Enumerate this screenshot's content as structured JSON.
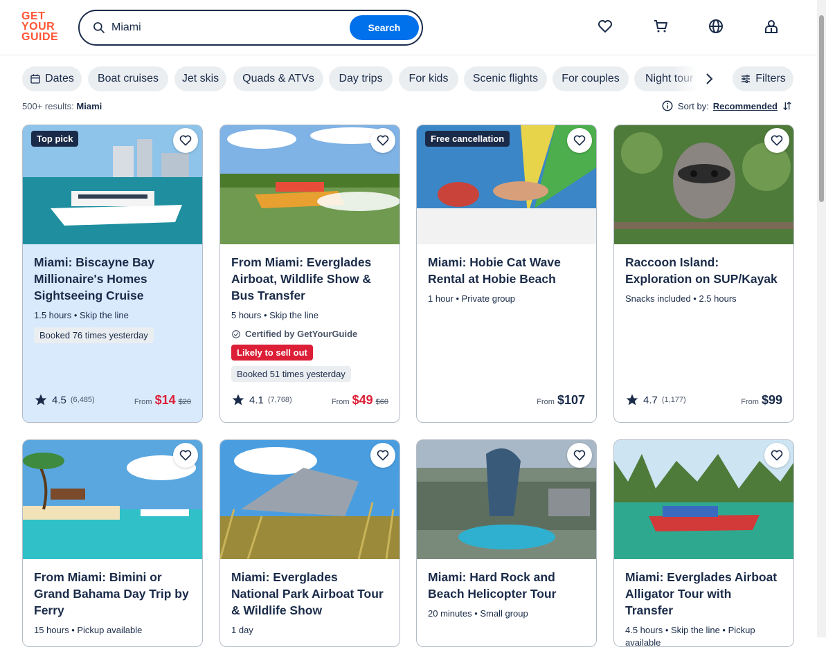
{
  "header": {
    "logo_lines": [
      "GET",
      "YOUR",
      "GUIDE"
    ],
    "search_value": "Miami",
    "search_button": "Search"
  },
  "chips": [
    "Dates",
    "Boat cruises",
    "Jet skis",
    "Quads & ATVs",
    "Day trips",
    "For kids",
    "Scenic flights",
    "For couples",
    "Night tour"
  ],
  "filters_label": "Filters",
  "results": {
    "count": "500+ results:",
    "query": "Miami"
  },
  "sort": {
    "label": "Sort by:",
    "value": "Recommended"
  },
  "cards": [
    {
      "tag": "Top pick",
      "title": "Miami: Biscayne Bay Millionaire's Homes Sightseeing Cruise",
      "meta": "1.5 hours • Skip the line",
      "booked": "Booked 76 times yesterday",
      "rating": "4.5",
      "reviews": "(6,485)",
      "from": "From",
      "price": "$14",
      "old": "$20"
    },
    {
      "title": "From Miami: Everglades Airboat, Wildlife Show & Bus Transfer",
      "meta": "5 hours • Skip the line",
      "cert": "Certified by GetYourGuide",
      "alert": "Likely to sell out",
      "booked": "Booked 51 times yesterday",
      "rating": "4.1",
      "reviews": "(7,768)",
      "from": "From",
      "price": "$49",
      "old": "$60"
    },
    {
      "tag": "Free cancellation",
      "title": "Miami: Hobie Cat Wave Rental at Hobie Beach",
      "meta": "1 hour • Private group",
      "from": "From",
      "price": "$107"
    },
    {
      "title": "Raccoon Island: Exploration on SUP/Kayak",
      "meta": "Snacks included • 2.5 hours",
      "rating": "4.7",
      "reviews": "(1,177)",
      "from": "From",
      "price": "$99"
    },
    {
      "title": "From Miami: Bimini or Grand Bahama Day Trip by Ferry",
      "meta": "15 hours • Pickup available"
    },
    {
      "title": "Miami: Everglades National Park Airboat Tour & Wildlife Show",
      "meta": "1 day"
    },
    {
      "title": "Miami: Hard Rock and Beach Helicopter Tour",
      "meta": "20 minutes • Small group"
    },
    {
      "title": "Miami: Everglades Airboat Alligator Tour with Transfer",
      "meta": "4.5 hours • Skip the line • Pickup available"
    }
  ],
  "colors": {
    "brand": "#ff5533",
    "accent": "#0071eb",
    "navy": "#1a2b49",
    "sale": "#dc1e36"
  }
}
